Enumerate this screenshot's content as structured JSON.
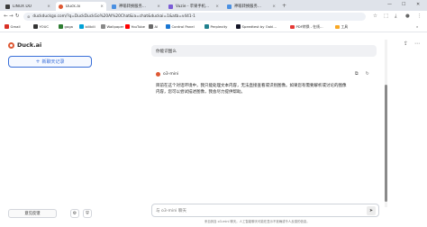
{
  "browser": {
    "tabs": [
      {
        "title": "LINUX DO",
        "fav_color": "#3c3c3c",
        "active": false
      },
      {
        "title": "Duck.ai",
        "fav_color": "#de5833",
        "active": true
      },
      {
        "title": "神喻转换服务…",
        "fav_color": "#4a90e2",
        "active": false
      },
      {
        "title": "Vuzie - 苹果手机…",
        "fav_color": "#7b5cd6",
        "active": false
      },
      {
        "title": "神喻转换服务…",
        "fav_color": "#4a90e2",
        "active": false
      }
    ],
    "new_tab": "+",
    "window_controls": {
      "minimize": "—",
      "maximize": "☐",
      "close": "✕"
    },
    "tab_close": "×",
    "url": "duckduckgo.com/?q=DuckDuckGo%20AI%20Chat&ia=chat&duckai=1&atb=v441-1",
    "bookmarks": [
      {
        "label": "Gmail",
        "color": "#d93025"
      },
      {
        "label": "YOUC",
        "color": "#333333"
      },
      {
        "label": "gaga",
        "color": "#2e7d32"
      },
      {
        "label": "bilibili",
        "color": "#00a1d6"
      },
      {
        "label": "Wallpaper",
        "color": "#888888"
      },
      {
        "label": "YouTube",
        "color": "#ff0000"
      },
      {
        "label": "AI",
        "color": "#6a6a6a"
      },
      {
        "label": "Control Panel",
        "color": "#1976d2"
      },
      {
        "label": "Perplexity",
        "color": "#20808d"
      },
      {
        "label": "Speedtest by Ookl…",
        "color": "#141526"
      },
      {
        "label": "PDF转换 - 在线…",
        "color": "#e53935"
      },
      {
        "label": "工具",
        "color": "#f9a825"
      }
    ],
    "bookmark_overflow": "»"
  },
  "sidebar": {
    "brand": "Duck.ai",
    "new_chat": "新聊天记录",
    "new_chat_plus": "+",
    "feedback": "意见反馈",
    "settings_icon": "⚙",
    "shield_icon": "⛨"
  },
  "main": {
    "user_message": "你能识图么",
    "model_name": "o3-mini",
    "reply_line1": "目前在这个对话环境中，我只能处理文本内容，无法直接查看或识别图像。如果您有需要解析或讨论的图像",
    "reply_line2": "内容，您可以尝试描述图像，我会尽力提供帮助。",
    "composer_placeholder": "与 o3-mini 聊天",
    "send_icon": "➤",
    "disclaimer": "来自其自 o3-mini 聊天。人工智能聊天可能在显示不准确或令人反感的信息。"
  }
}
